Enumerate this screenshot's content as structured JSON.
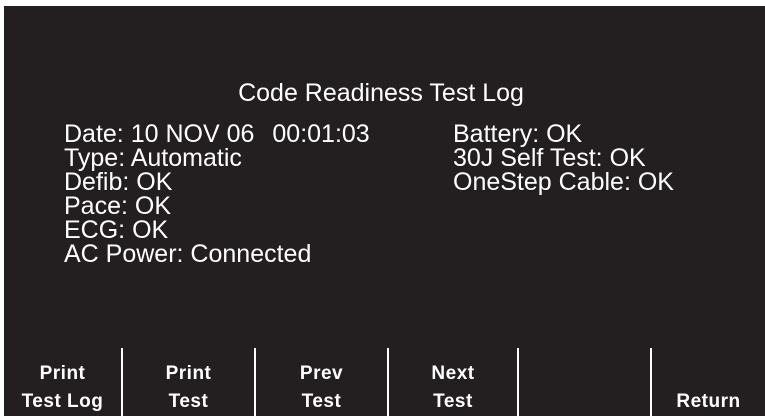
{
  "screen": {
    "title": "Code Readiness Test Log"
  },
  "left_column": {
    "date_label": "Date: 10 NOV 06",
    "time": "00:01:03",
    "type": "Type: Automatic",
    "defib": "Defib: OK",
    "pace": "Pace: OK",
    "ecg": "ECG: OK",
    "ac_power": "AC Power: Connected"
  },
  "right_column": {
    "battery": "Battery: OK",
    "self_test": "30J Self Test: OK",
    "cable": "OneStep Cable: OK"
  },
  "softkeys": {
    "print_test_log": {
      "line1": "Print",
      "line2": "Test Log"
    },
    "print_test": {
      "line1": "Print",
      "line2": "Test"
    },
    "prev_test": {
      "line1": "Prev",
      "line2": "Test"
    },
    "next_test": {
      "line1": "Next",
      "line2": "Test"
    },
    "blank": {
      "line1": "",
      "line2": ""
    },
    "return": {
      "line1": "",
      "line2": "Return"
    }
  },
  "colors": {
    "background": "#231f20",
    "text": "#ffffff"
  }
}
